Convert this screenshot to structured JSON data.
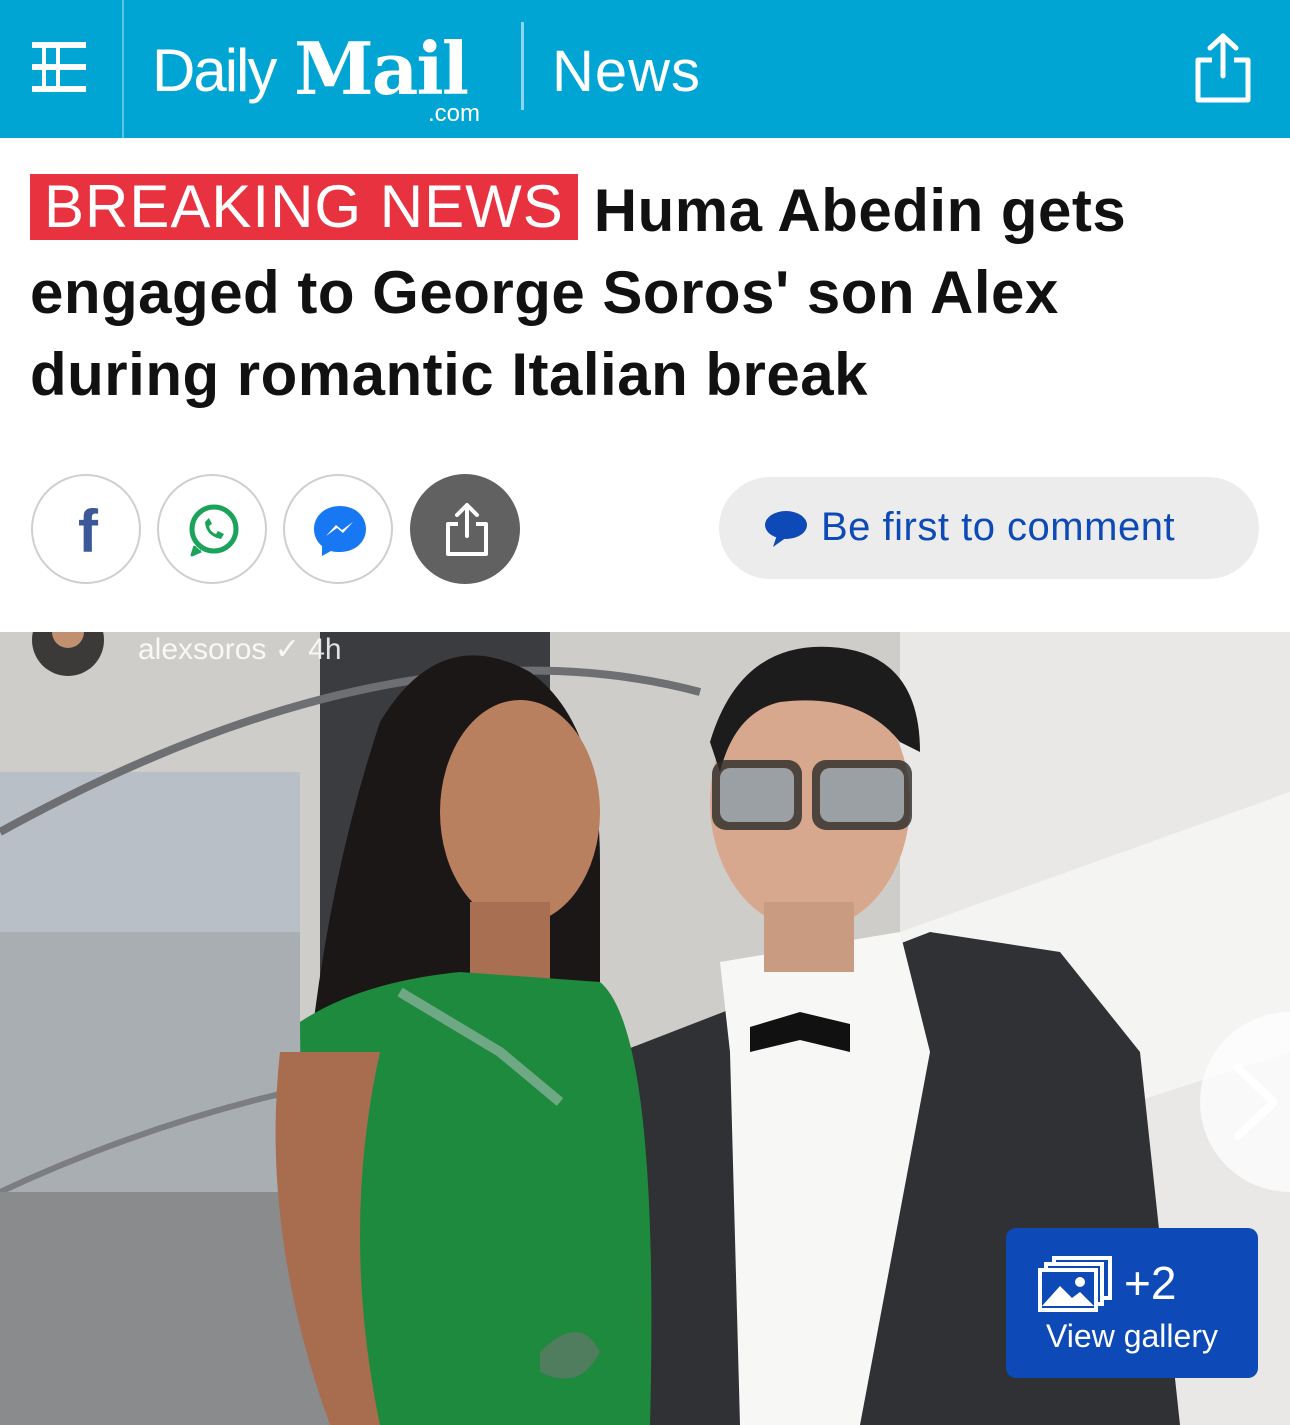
{
  "header": {
    "logo_daily": "Daily",
    "logo_mail": "Mail",
    "logo_com": ".com",
    "section": "News",
    "bg_color": "#00a5d4"
  },
  "article": {
    "badge": "BREAKING NEWS",
    "badge_color": "#e8323f",
    "headline": "Huma Abedin gets engaged to George Soros' son Alex during romantic Italian break"
  },
  "share": {
    "buttons": [
      {
        "icon": "facebook-icon"
      },
      {
        "icon": "whatsapp-icon"
      },
      {
        "icon": "messenger-icon"
      },
      {
        "icon": "share-icon"
      }
    ],
    "comment_label": "Be first to comment",
    "comment_color": "#0d4ab7"
  },
  "photo": {
    "overlay_handle": "alexsoros",
    "overlay_time": "4h",
    "gallery_count": "+2",
    "gallery_label": "View gallery"
  }
}
